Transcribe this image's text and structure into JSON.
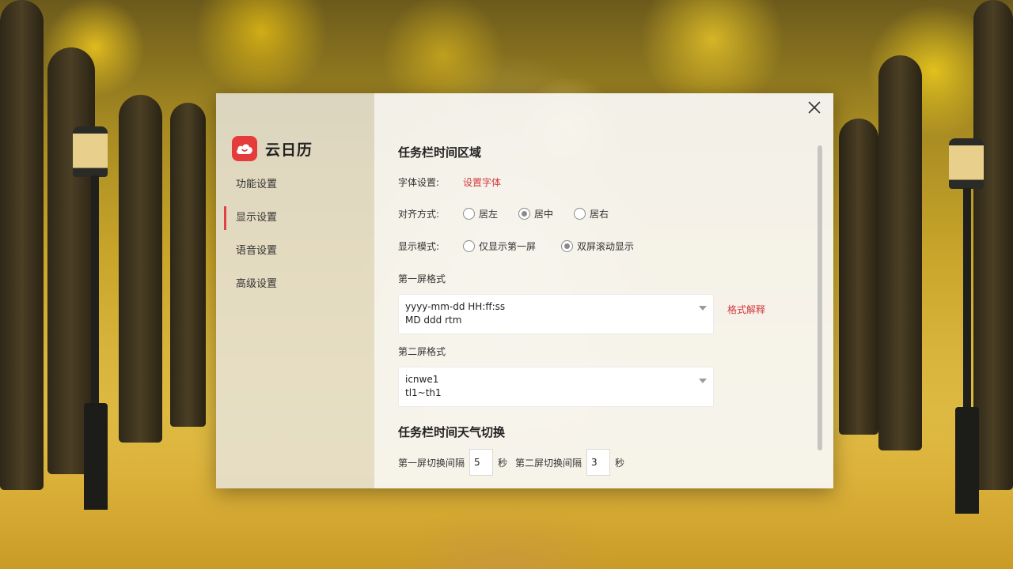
{
  "app": {
    "name": "云日历"
  },
  "sidebar": {
    "items": [
      {
        "label": "功能设置"
      },
      {
        "label": "显示设置"
      },
      {
        "label": "语音设置"
      },
      {
        "label": "高级设置"
      }
    ],
    "active_index": 1
  },
  "content": {
    "section1": {
      "title": "任务栏时间区域",
      "font": {
        "label": "字体设置:",
        "link": "设置字体"
      },
      "align": {
        "label": "对齐方式:",
        "options": [
          "居左",
          "居中",
          "居右"
        ],
        "selected": "居中"
      },
      "display_mode": {
        "label": "显示模式:",
        "options": [
          "仅显示第一屏",
          "双屏滚动显示"
        ],
        "selected": "双屏滚动显示"
      },
      "first_screen": {
        "label": "第一屏格式",
        "line1": "yyyy-mm-dd HH:ff:ss",
        "line2": "MD ddd rtm",
        "help_link": "格式解释"
      },
      "second_screen": {
        "label": "第二屏格式",
        "line1": "icnwe1",
        "line2": "tl1~th1"
      }
    },
    "section2": {
      "title": "任务栏时间天气切换",
      "first_interval_label": "第一屏切换间隔",
      "first_interval_value": "5",
      "second_interval_label": "第二屏切换间隔",
      "second_interval_value": "3",
      "unit": "秒"
    }
  },
  "colors": {
    "accent": "#e0404a",
    "link": "#d3393f",
    "logo_bg": "#e63b3b"
  },
  "icons": {
    "logo": "cloud-icon",
    "close": "close-icon",
    "dropdown": "chevron-down-icon"
  }
}
